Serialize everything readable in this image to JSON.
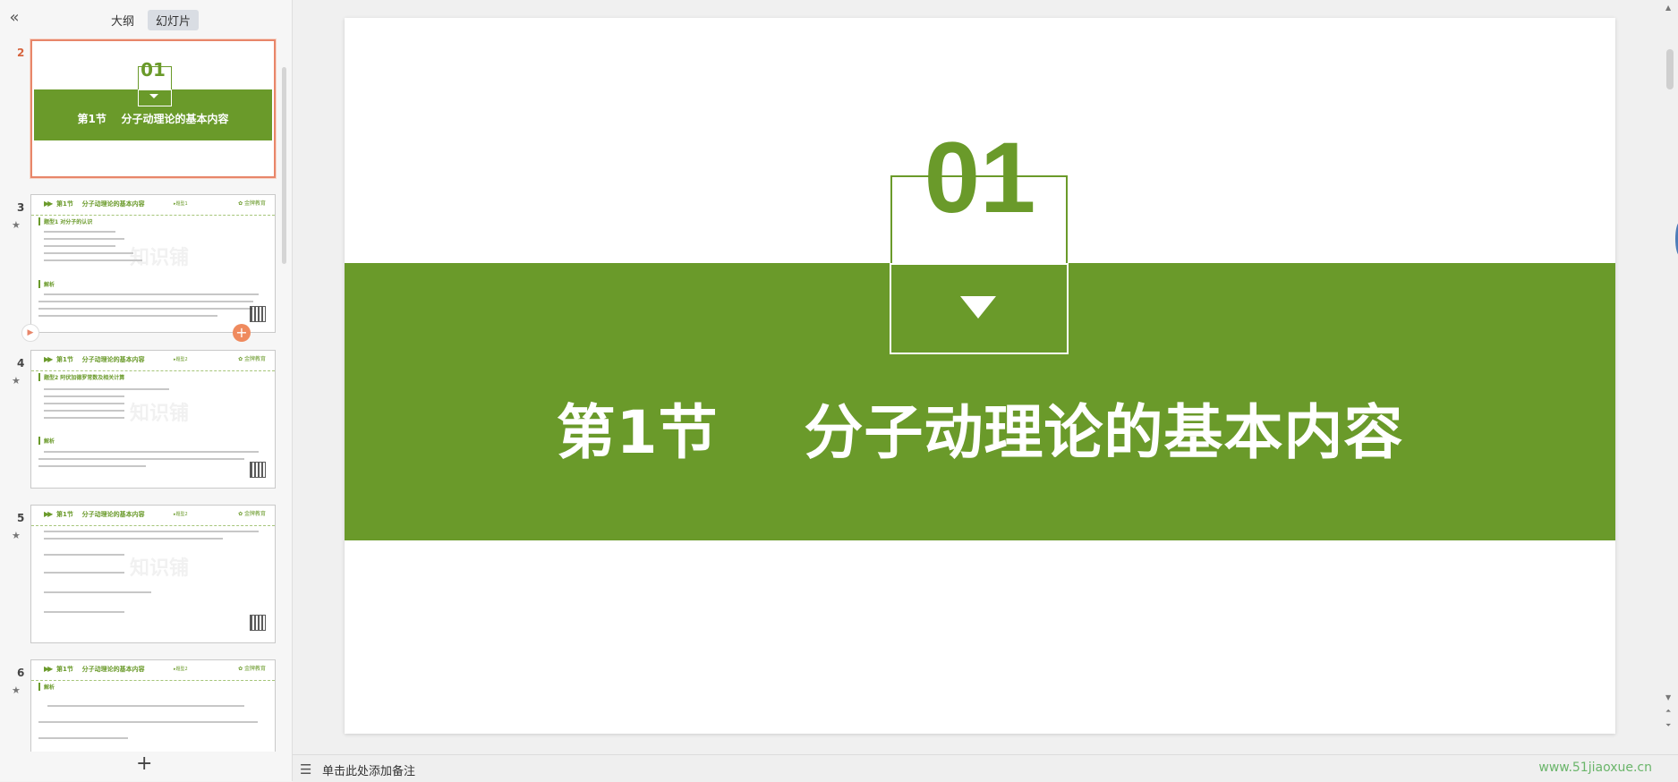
{
  "sidebar": {
    "collapse_icon": "double-chevron-left-icon",
    "tabs": [
      {
        "label": "大纲",
        "active": false
      },
      {
        "label": "幻灯片",
        "active": true
      }
    ],
    "slides": [
      {
        "number": "2",
        "title": "第1节    分子动理论的基本内容",
        "big_number": "01",
        "selected": true
      },
      {
        "number": "3",
        "header": "第1节    分子动理论的基本内容",
        "tag": "▸题型1",
        "logo": "✿ 金牌教育",
        "section1": "题型1  对分子的认识",
        "section2": "解析",
        "watermark": "知识铺",
        "starred": true
      },
      {
        "number": "4",
        "header": "第1节    分子动理论的基本内容",
        "tag": "▸题型2",
        "logo": "✿ 金牌教育",
        "section1": "题型2  阿伏加德罗常数及相关计算",
        "section2": "解析",
        "watermark": "知识铺",
        "starred": true
      },
      {
        "number": "5",
        "header": "第1节    分子动理论的基本内容",
        "tag": "▸题型2",
        "logo": "✿ 金牌教育",
        "watermark": "知识铺",
        "starred": true
      },
      {
        "number": "6",
        "header": "第1节    分子动理论的基本内容",
        "tag": "▸题型2",
        "logo": "✿ 金牌教育",
        "section1": "解析",
        "starred": true
      }
    ],
    "add_slide_icon": "plus-icon"
  },
  "slide": {
    "big_number": "01",
    "title": "第1节    分子动理论的基本内容",
    "accent_color": "#6a9a2a"
  },
  "notes": {
    "placeholder": "单击此处添加备注",
    "icon": "notes-list-icon"
  },
  "watermark": "www.51jiaoxue.cn"
}
